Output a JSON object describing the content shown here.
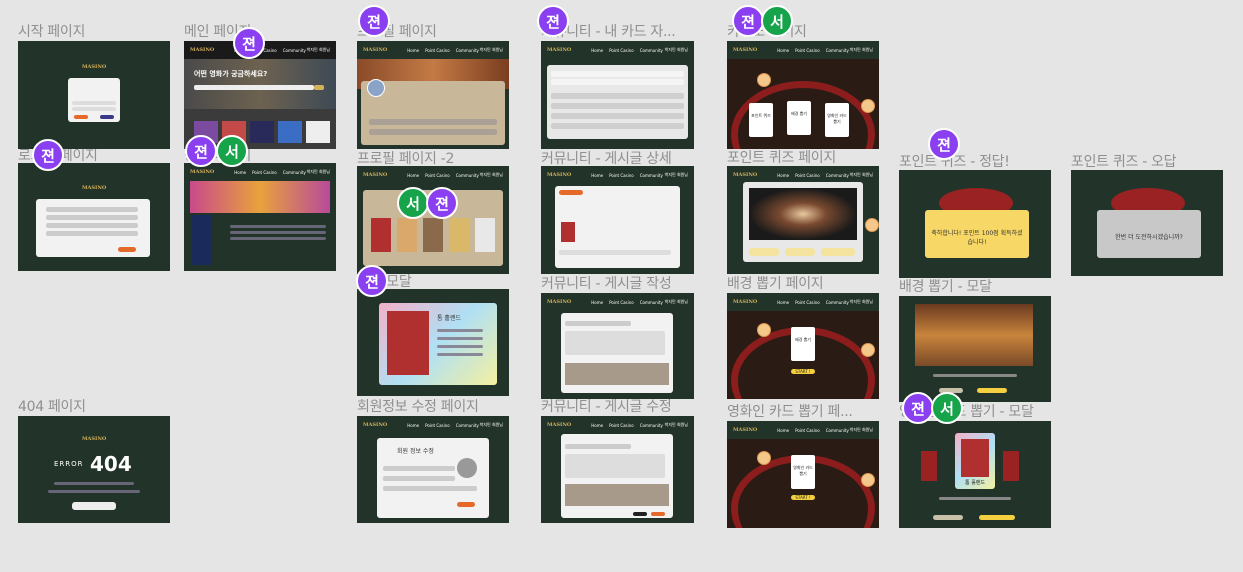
{
  "labels": {
    "start": "시작 페이지",
    "main": "메인 페이지",
    "profile": "프로필 페이지",
    "community_mycard": "커뮤니티 - 내 카드 자...",
    "casino": "카지노 페이지",
    "login": "로그인 페이지",
    "detail": "상세 페이지",
    "profile2": "프로필 페이지 -2",
    "community_detail": "커뮤니티 - 게시글 상세",
    "point_quiz": "포인트 퀴즈 페이지",
    "quiz_correct": "포인트 퀴즈 - 정답!",
    "quiz_wrong": "포인트 퀴즈 - 오답",
    "card_modal": "카드 모달",
    "community_write": "커뮤니티 - 게시글 작성",
    "bg_draw": "배경 뽑기 페이지",
    "bg_draw_modal": "배경 뽑기 - 모달",
    "page404": "404 페이지",
    "member_edit": "회원정보 수정 페이지",
    "community_edit": "커뮤니티 - 게시글 수정",
    "person_draw": "영화인 카드 뽑기 페...",
    "person_draw_modal": "영화인 카드 뽑기 - 모달"
  },
  "nav": {
    "logo": "MASINO",
    "links": [
      "Home",
      "Point Casino",
      "Community"
    ],
    "right": "박지민 회원님"
  },
  "avatars": {
    "j": "젼",
    "s": "서"
  },
  "content": {
    "main_question": "어떤 영화가 궁금하세요?",
    "quiz_correct_text": "축하합니다! 포인트 100점 획득하셨습니다!",
    "quiz_wrong_text": "한번 더 도전하시겠습니까?",
    "error_text": "ERROR",
    "error_code": "404",
    "member_edit_title": "회원 정보 수정",
    "card_name": "톰 홀랜드",
    "start_btn": "START !",
    "cards": [
      "포인트 퀴즈",
      "배경 뽑기",
      "영화인 카드 뽑기"
    ],
    "bg_card": "배경 뽑기",
    "person_card": "영화인 카드 뽑기",
    "modal_name": "톰 홀랜드"
  },
  "colors": {
    "frame": "#22332a",
    "avatar_purple": "#8a3ff0",
    "avatar_green": "#16a34a",
    "felt_red": "#8b1d1d",
    "gold": "#d4b25a"
  }
}
